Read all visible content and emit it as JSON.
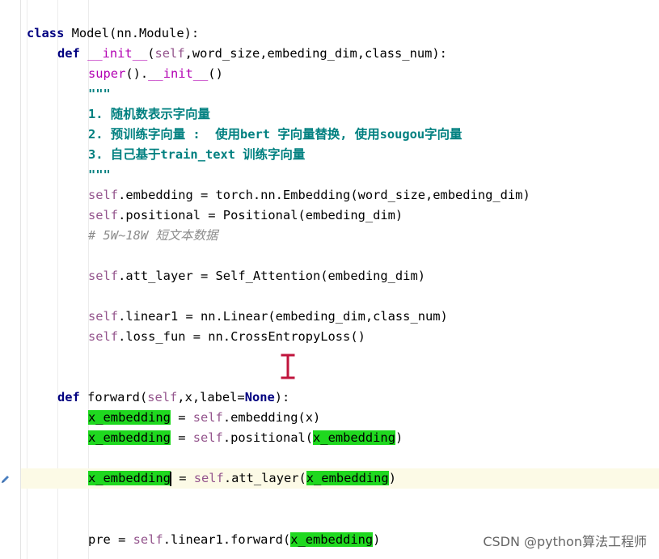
{
  "code": {
    "l1": {
      "t1": "class",
      "t2": " Model(nn.Module):"
    },
    "l2": {
      "t1": "def",
      "t2": " ",
      "t3": "__init__",
      "t4": "(",
      "t5": "self",
      "t6": ",word_size,embeding_dim,class_num):"
    },
    "l3": {
      "t1": "super",
      "t2": "().",
      "t3": "__init__",
      "t4": "()"
    },
    "l4": {
      "t1": "\"\"\""
    },
    "l5": {
      "t1": "1. 随机数表示字向量"
    },
    "l6": {
      "t1": "2. 预训练字向量 :  使用bert 字向量替换, 使用sougou字向量"
    },
    "l7": {
      "t1": "3. 自己基于train_text 训练字向量"
    },
    "l8": {
      "t1": "\"\"\""
    },
    "l9": {
      "t1": "self",
      "t2": ".embedding = torch.nn.Embedding(word_size,embeding_dim)"
    },
    "l10": {
      "t1": "self",
      "t2": ".positional = Positional(embeding_dim)"
    },
    "l11": {
      "t1": "# 5W~18W 短文本数据"
    },
    "l12": {
      "t1": "self",
      "t2": ".att_layer = Self_Attention(embeding_dim)"
    },
    "l13": {
      "t1": "self",
      "t2": ".linear1 = nn.Linear(embeding_dim,class_num)"
    },
    "l14": {
      "t1": "self",
      "t2": ".loss_fun = nn.CrossEntropyLoss()"
    },
    "l15": {
      "t1": "def",
      "t2": " forward(",
      "t3": "self",
      "t4": ",x,label=",
      "t5": "None",
      "t6": "):"
    },
    "l16": {
      "t1": "x_embedding",
      "t2": " = ",
      "t3": "self",
      "t4": ".embedding(x)"
    },
    "l17": {
      "t1": "x_embedding",
      "t2": " = ",
      "t3": "self",
      "t4": ".positional(",
      "t5": "x_embedding",
      "t6": ")"
    },
    "l18": {
      "t1": "x_embedding",
      "t2": " = ",
      "t3": "self",
      "t4": ".att_layer(",
      "t5": "x_embedding",
      "t6": ")"
    },
    "l19": {
      "t1": "pre = ",
      "t2": "self",
      "t3": ".linear1.forward(",
      "t4": "x_embedding",
      "t5": ")"
    }
  },
  "icons": {
    "cursor": "text-cursor-icon",
    "gutter_edit": "pencil-icon"
  },
  "colors": {
    "keyword": "#000080",
    "self": "#94558d",
    "dunder": "#b200b2",
    "docstring": "#008080",
    "comment": "#8c8c8c",
    "highlight": "#1fd81f",
    "caret_line": "#fcfae6"
  },
  "watermark": "CSDN @python算法工程师"
}
